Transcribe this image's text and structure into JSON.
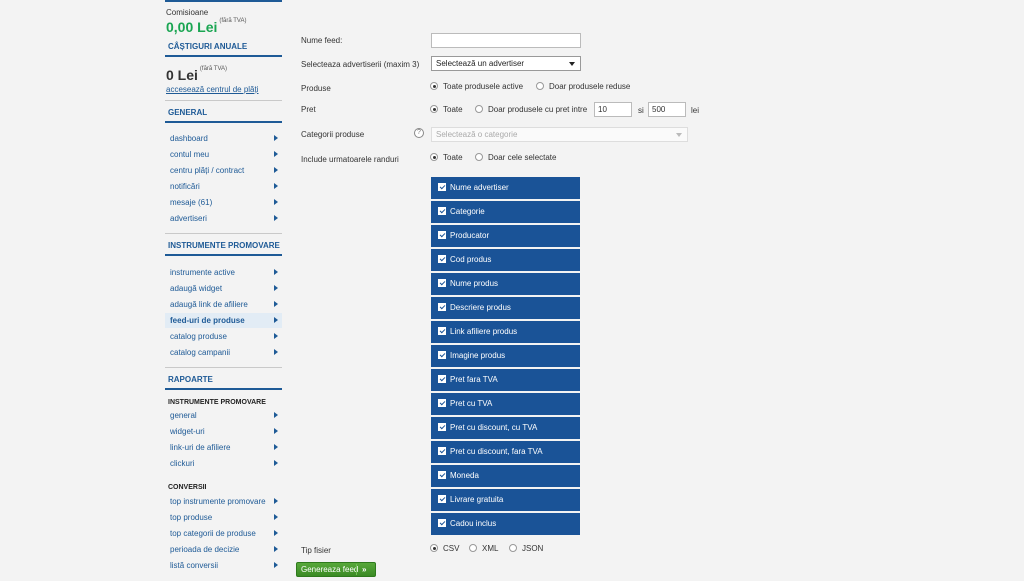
{
  "sidebar": {
    "commissions_label": "Comisioane",
    "commissions_value": "0,00 Lei",
    "tva_note": "(fără TVA)",
    "annual_title": "CÂȘTIGURI ANUALE",
    "annual_value": "0 Lei",
    "payments_link": "accesează centrul de plăți",
    "general_title": "GENERAL",
    "general_items": [
      "dashboard",
      "contul meu",
      "centru plăți / contract",
      "notificări",
      "mesaje (61)",
      "advertiseri"
    ],
    "promo_title": "INSTRUMENTE PROMOVARE",
    "promo_items": [
      "instrumente active",
      "adaugă widget",
      "adaugă link de afiliere",
      "feed-uri de produse",
      "catalog produse",
      "catalog campanii"
    ],
    "reports_title": "RAPOARTE",
    "reports_sub1": "INSTRUMENTE PROMOVARE",
    "reports_items1": [
      "general",
      "widget-uri",
      "link-uri de afiliere",
      "clickuri"
    ],
    "reports_sub2": "CONVERSII",
    "reports_items2": [
      "top instrumente promovare",
      "top produse",
      "top categorii de produse",
      "perioada de decizie",
      "listă conversii"
    ]
  },
  "form": {
    "feed_name_label": "Nume feed:",
    "feed_name_value": "",
    "advertisers_label": "Selecteaza advertiserii (maxim 3)",
    "advertisers_value": "Selectează un advertiser",
    "products_label": "Produse",
    "products_opt1": "Toate produsele active",
    "products_opt2": "Doar produsele reduse",
    "price_label": "Pret",
    "price_opt1": "Toate",
    "price_opt2": "Doar produsele cu pret intre",
    "price_min": "10",
    "price_and": "si",
    "price_max": "500",
    "price_unit": "lei",
    "categories_label": "Categorii produse",
    "help_icon": "?",
    "categories_placeholder": "Selectează o categorie",
    "rows_label": "Include urmatoarele randuri",
    "rows_opt1": "Toate",
    "rows_opt2": "Doar cele selectate",
    "columns": [
      "Nume advertiser",
      "Categorie",
      "Producator",
      "Cod produs",
      "Nume produs",
      "Descriere produs",
      "Link afiliere produs",
      "Imagine produs",
      "Pret fara TVA",
      "Pret cu TVA",
      "Pret cu discount, cu TVA",
      "Pret cu discount, fara TVA",
      "Moneda",
      "Livrare gratuita",
      "Cadou inclus"
    ],
    "filetype_label": "Tip fisier",
    "filetype_opts": [
      "CSV",
      "XML",
      "JSON"
    ],
    "generate_label": "Genereaza feed",
    "generate_chevron": "»"
  },
  "colors": {
    "accent": "#1e5a96",
    "money": "#1aa552",
    "column_bg": "#1a5397",
    "button": "#3a8a24"
  }
}
